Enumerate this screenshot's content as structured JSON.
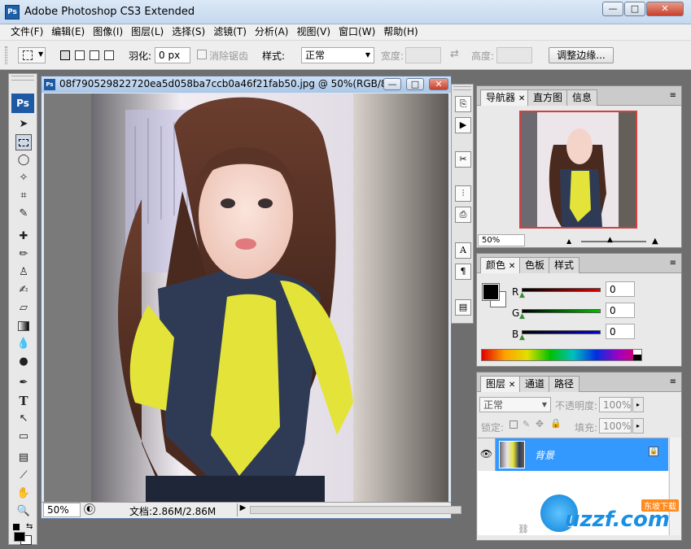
{
  "window": {
    "title": "Adobe Photoshop CS3 Extended",
    "app_icon_label": "Ps",
    "minimize_symbol": "—",
    "maximize_symbol": "□",
    "close_symbol": "✕"
  },
  "menu": [
    "文件(F)",
    "编辑(E)",
    "图像(I)",
    "图层(L)",
    "选择(S)",
    "滤镜(T)",
    "分析(A)",
    "视图(V)",
    "窗口(W)",
    "帮助(H)"
  ],
  "options": {
    "feather_label": "羽化:",
    "feather_value": "0 px",
    "antialias_label": "消除锯齿",
    "style_label": "样式:",
    "style_value": "正常",
    "width_label": "宽度:",
    "height_label": "高度:",
    "refine_label": "调整边缘..."
  },
  "document": {
    "title": "08f790529822720ea5d058ba7ccb0a46f21fab50.jpg @ 50%(RGB/8)",
    "icon_label": "Ps",
    "zoom": "50%",
    "doc_size": "文档:2.86M/2.86M"
  },
  "toolbox": {
    "logo": "Ps"
  },
  "navigator": {
    "tabs": [
      "导航器",
      "直方图",
      "信息"
    ],
    "zoom": "50%"
  },
  "color": {
    "tabs": [
      "颜色",
      "色板",
      "样式"
    ],
    "r_label": "R",
    "g_label": "G",
    "b_label": "B",
    "r_value": "0",
    "g_value": "0",
    "b_value": "0"
  },
  "layers": {
    "tabs": [
      "图层",
      "通道",
      "路径"
    ],
    "blend_mode": "正常",
    "opacity_label": "不透明度:",
    "opacity_value": "100%",
    "lock_label": "锁定:",
    "fill_label": "填充:",
    "fill_value": "100%",
    "layer_name": "背景"
  },
  "watermark": {
    "text": "uzzf.com",
    "tag": "东坡下载"
  },
  "colors": {
    "accent_blue": "#3399ff",
    "title_bar": "#c4d8ee",
    "selected_layer": "#3399ff"
  }
}
